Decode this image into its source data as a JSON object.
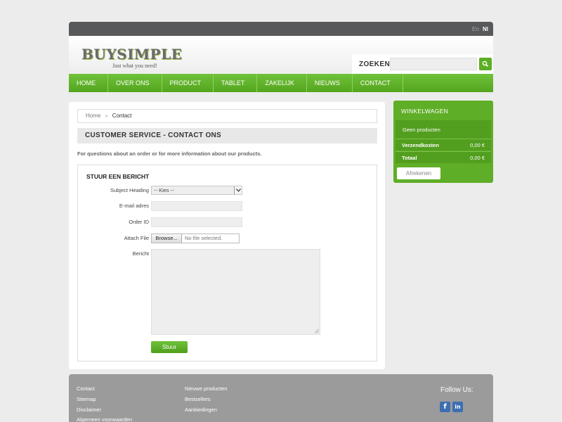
{
  "topbar": {
    "lang_en": "En",
    "lang_nl": "Nl"
  },
  "header": {
    "logo": "BUYSIMPLE",
    "tagline": "Just what you need!",
    "search_label": "ZOEKEN",
    "search_value": ""
  },
  "nav": {
    "items": [
      "HOME",
      "OVER ONS",
      "PRODUCT",
      "TABLET",
      "ZAKELIJK",
      "NIEUWS",
      "CONTACT"
    ]
  },
  "breadcrumb": {
    "home": "Home",
    "separator": "»",
    "current": "Contact"
  },
  "page": {
    "title": "CUSTOMER SERVICE - CONTACT ONS",
    "intro": "For questions about an order or for more information about our products."
  },
  "form": {
    "heading": "STUUR EEN BERICHT",
    "subject_label": "Subject Heading",
    "subject_value": "-- Kies --",
    "email_label": "E-mail adres",
    "order_label": "Order ID",
    "attach_label": "Attach File",
    "browse_label": "Browse...",
    "file_status": "No file selected.",
    "message_label": "Bericht",
    "submit_label": "Stuur"
  },
  "cart": {
    "title": "WINKELWAGEN",
    "empty_text": "Geen producten",
    "shipping_label": "Verzendkosten",
    "shipping_value": "0,00 €",
    "total_label": "Totaal",
    "total_value": "0,00 €",
    "checkout_label": "Afrekenen"
  },
  "footer": {
    "col1": [
      "Contact",
      "Sitemap",
      "Disclaimer",
      "Algemeen voorwaarden"
    ],
    "col2": [
      "Nieuwe producten",
      "Bestsellers",
      "Aanbiedingen"
    ],
    "follow_label": "Follow Us:",
    "facebook_glyph": "f",
    "linkedin_glyph": "in"
  },
  "colors": {
    "accent_green": "#5fae27",
    "topbar": "#58595b",
    "footer": "#9b9b9c"
  }
}
